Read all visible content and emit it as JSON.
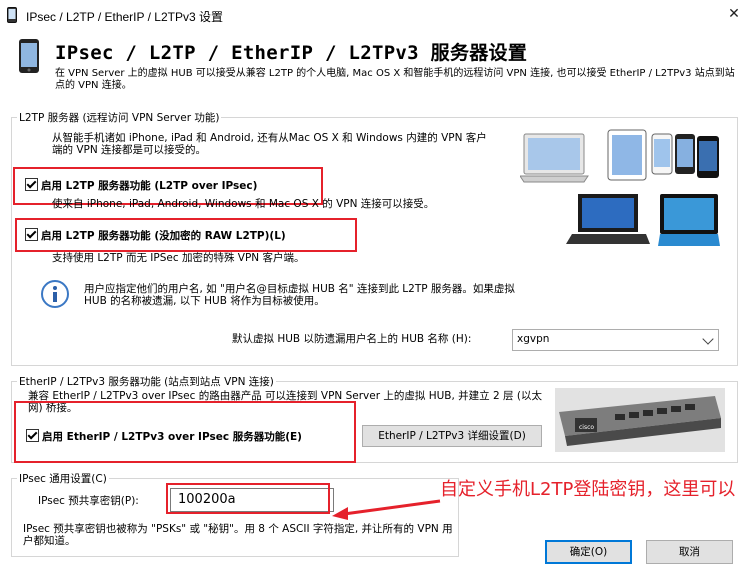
{
  "window": {
    "title": "IPsec / L2TP / EtherIP / L2TPv3 设置",
    "close_glyph": "✕"
  },
  "header": {
    "title": "IPsec / L2TP / EtherIP / L2TPv3 服务器设置",
    "description": "在 VPN Server 上的虚拟 HUB 可以接受从兼容 L2TP 的个人电脑, Mac OS X 和智能手机的远程访问 VPN 连接, 也可以接受 EtherIP / L2TPv3 站点到站点的 VPN 连接。"
  },
  "l2tp_group": {
    "legend": "L2TP 服务器 (远程访问 VPN Server 功能)",
    "intro": "从智能手机诸如 iPhone, iPad 和 Android, 还有从Mac OS X 和 Windows 内建的 VPN 客户端的 VPN 连接都是可以接受的。",
    "enable_l2tp_ipsec": {
      "label": "启用 L2TP 服务器功能 (L2TP over IPsec)",
      "checked": true
    },
    "enable_l2tp_ipsec_desc": "使来自 iPhone, iPad, Android, Windows 和 Mac OS X 的 VPN 连接可以接受。",
    "enable_l2tp_raw": {
      "label": "启用 L2TP 服务器功能 (没加密的 RAW L2TP)(L)",
      "checked": true
    },
    "enable_l2tp_raw_desc": "支持使用 L2TP 而无 IPSec 加密的特殊 VPN 客户端。",
    "info_text": "用户应指定他们的用户名, 如 \"用户名@目标虚拟 HUB 名\" 连接到此 L2TP 服务器。如果虚拟 HUB 的名称被遗漏, 以下 HUB 将作为目标被使用。",
    "default_hub_label": "默认虚拟 HUB 以防遗漏用户名上的 HUB 名称 (H):",
    "default_hub_value": "xgvpn",
    "info_icon": "info-icon"
  },
  "etherip_group": {
    "legend": "EtherIP / L2TPv3 服务器功能 (站点到站点 VPN 连接)",
    "intro": "兼容 EtherIP / L2TPv3 over IPsec 的路由器产品 可以连接到 VPN Server 上的虚拟 HUB, 并建立 2 层 (以太网) 桥接。",
    "enable_etherip": {
      "label": "启用 EtherIP / L2TPv3 over IPsec 服务器功能(E)",
      "checked": true
    },
    "detail_button": "EtherIP / L2TPv3 详细设置(D)",
    "router_brand": "cisco"
  },
  "ipsec_group": {
    "legend": "IPsec 通用设置(C)",
    "psk_label": "IPsec 预共享密钥(P):",
    "psk_value": "100200a",
    "note": "IPsec 预共享密钥也被称为 \"PSKs\" 或 \"秘钥\"。用 8 个 ASCII 字符指定, 并让所有的 VPN 用户都知道。"
  },
  "annotation": {
    "text": "自定义手机L2TP登陆密钥，这里可以",
    "color": "#e5212b"
  },
  "buttons": {
    "ok": "确定(O)",
    "cancel": "取消"
  }
}
